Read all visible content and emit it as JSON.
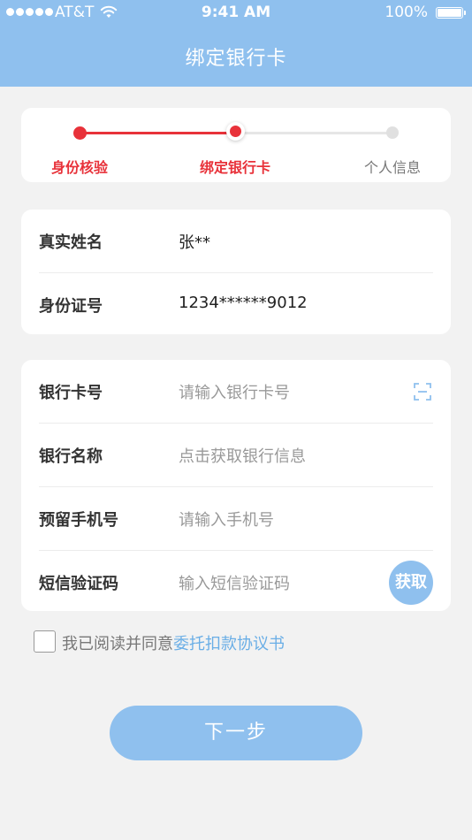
{
  "status_bar": {
    "carrier": "AT&T",
    "time": "9:41 AM",
    "battery": "100%"
  },
  "nav": {
    "title": "绑定银行卡"
  },
  "stepper": {
    "steps": [
      {
        "label": "身份核验",
        "state": "done"
      },
      {
        "label": "绑定银行卡",
        "state": "current"
      },
      {
        "label": "个人信息",
        "state": "todo"
      }
    ]
  },
  "identity": {
    "name_label": "真实姓名",
    "name_value": "张**",
    "id_label": "身份证号",
    "id_value": "1234******9012"
  },
  "bank_form": {
    "card_label": "银行卡号",
    "card_placeholder": "请输入银行卡号",
    "bank_label": "银行名称",
    "bank_placeholder": "点击获取银行信息",
    "phone_label": "预留手机号",
    "phone_placeholder": "请输入手机号",
    "sms_label": "短信验证码",
    "sms_placeholder": "输入短信验证码",
    "get_code_label": "获取"
  },
  "agreement": {
    "prefix": "我已阅读并同意",
    "link": "委托扣款协议书",
    "checked": false
  },
  "next_button": {
    "label": "下一步"
  },
  "colors": {
    "primary": "#8fc0ee",
    "active": "#e8323a",
    "link": "#6aaee6",
    "background": "#f2f2f2"
  }
}
